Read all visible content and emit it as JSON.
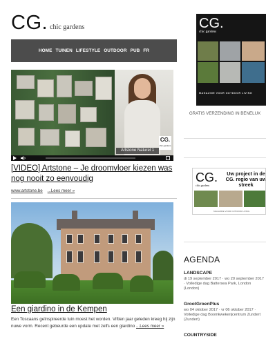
{
  "logo": {
    "main": "CG.",
    "sub": "chic gardens"
  },
  "nav": {
    "items": [
      "HOME",
      "TUINEN",
      "LIFESTYLE",
      "OUTDOOR",
      "PUB",
      "FR"
    ]
  },
  "video": {
    "caption": "Artstone Naturel 1",
    "logo_main": "CG.",
    "logo_sub": "chic gardens"
  },
  "articles": [
    {
      "title": "[VIDEO] Artstone – Je droomvloer kiezen was nog nooit zo eenvoudig",
      "source_link": "www.artstone.be",
      "read_more": "...Lees meer »"
    },
    {
      "title": "Een giardino in de Kempen",
      "excerpt": "Een Toscaans geïnspireerde tuin moest het worden. Viftien jaar geleden kreeg hij zijn nuwe vorm. Recent gebeurde een update met zelfs een giardino",
      "read_more": "...Lees meer »"
    }
  ],
  "sidebar": {
    "magazine": {
      "logo_main": "CG.",
      "logo_sub": "chic gardens",
      "tagline": "MAGAZINE VOOR OUTDOOR LIVING"
    },
    "shipping_text": "GRATIS VERZENDING IN BENELUX",
    "ad": {
      "logo_main": "CG.",
      "logo_sub": "chic gardens",
      "headline": "Uw project in de CG. regio van uw streek",
      "tagline": "MAGAZINE VOOR OUTDOOR LIVING"
    },
    "agenda": {
      "heading": "AGENDA",
      "events": [
        {
          "title": "LANDSCAPE",
          "info": "di 19 september 2017 · wo 20 september 2017 · Volledige dag Battersea Park, London (London)"
        },
        {
          "title": "GrootGroenPlus",
          "info": "wo 04 oktober 2017 · vr 06 oktober 2017 · Volledige dag Boomkwekerijcentrum Zundert (Zundert)"
        },
        {
          "title": "COUNTRYSIDE",
          "info": ""
        }
      ]
    }
  },
  "colors": {
    "nav_bg": "#4c4c4c",
    "nav_text": "#ffffff",
    "magazine_bg": "#151515",
    "link": "#111111"
  }
}
